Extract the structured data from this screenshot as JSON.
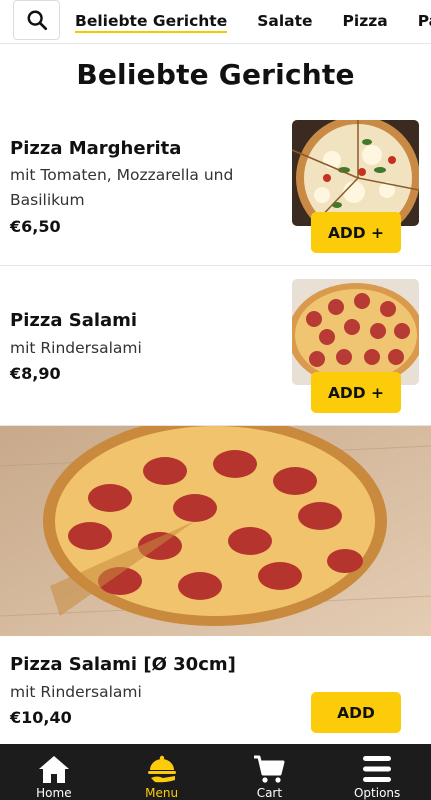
{
  "category_tabs": [
    {
      "label": "Beliebte Gerichte",
      "active": true
    },
    {
      "label": "Salate",
      "active": false
    },
    {
      "label": "Pizza",
      "active": false
    },
    {
      "label": "Pasta",
      "active": false
    }
  ],
  "page_title": "Beliebte Gerichte",
  "items": [
    {
      "name": "Pizza Margherita",
      "description": "mit Tomaten, Mozzarella und Basilikum",
      "price": "€6,50",
      "add_label": "ADD +"
    },
    {
      "name": "Pizza Salami",
      "description": "mit Rindersalami",
      "price": "€8,90",
      "add_label": "ADD +"
    },
    {
      "name": "Pizza Salami [Ø 30cm]",
      "description": "mit Rindersalami",
      "price": "€10,40",
      "add_label": "ADD"
    }
  ],
  "bottom_nav": [
    {
      "label": "Home",
      "icon": "home-icon",
      "active": false
    },
    {
      "label": "Menu",
      "icon": "menu-cloche-icon",
      "active": true
    },
    {
      "label": "Cart",
      "icon": "cart-icon",
      "active": false
    },
    {
      "label": "Options",
      "icon": "options-icon",
      "active": false
    }
  ],
  "colors": {
    "accent": "#fccc0a",
    "nav_bg": "#1c1c1c"
  }
}
